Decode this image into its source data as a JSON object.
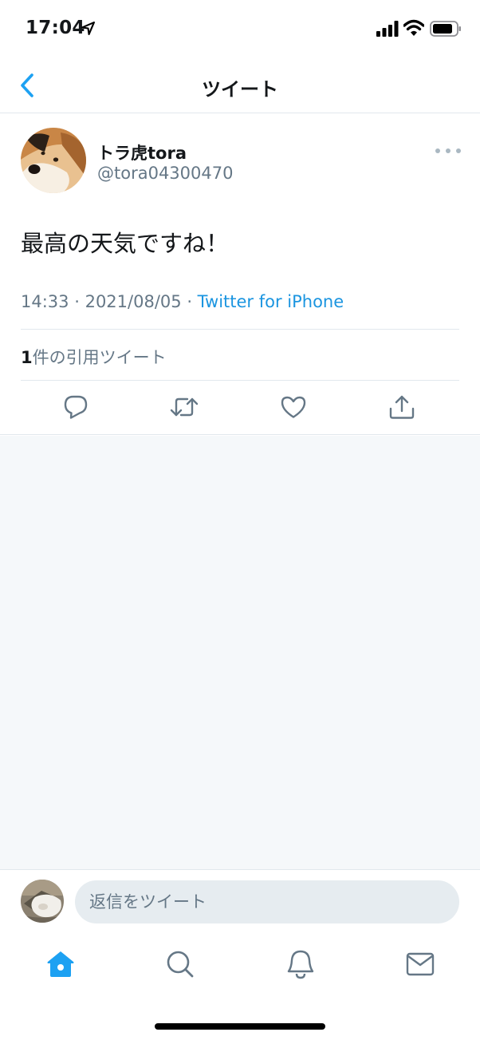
{
  "status_bar": {
    "time": "17:04"
  },
  "nav": {
    "title": "ツイート"
  },
  "tweet": {
    "display_name": "トラ虎tora",
    "handle": "@tora04300470",
    "text": "最高の天気ですね！",
    "time": "14:33",
    "date": "2021/08/05",
    "source": "Twitter for iPhone",
    "quote_count": "1",
    "quote_label": "件の引用ツイート"
  },
  "reply": {
    "placeholder": "返信をツイート"
  },
  "colors": {
    "accent": "#1da1f2",
    "link": "#1b95e0",
    "secondary_text": "#657786",
    "background": "#f5f8fa"
  },
  "icons": {
    "back": "chevron-left-icon",
    "more": "more-dots-icon",
    "reply": "reply-bubble-icon",
    "retweet": "retweet-icon",
    "like": "heart-icon",
    "share": "share-icon",
    "home": "home-icon",
    "search": "search-icon",
    "notifications": "bell-icon",
    "messages": "mail-icon"
  }
}
